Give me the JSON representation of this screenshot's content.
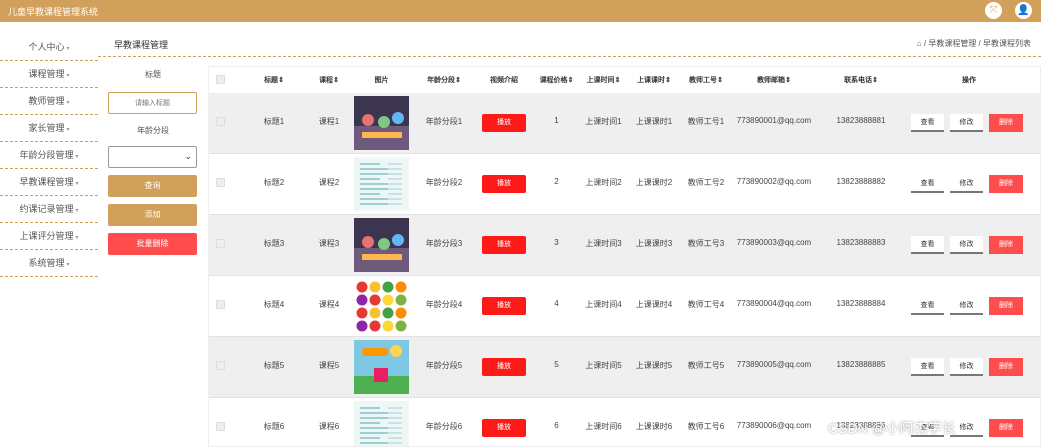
{
  "app": {
    "title": "儿童早教课程管理系统"
  },
  "sidebar": {
    "items": [
      {
        "label": "个人中心"
      },
      {
        "label": "课程管理"
      },
      {
        "label": "教师管理"
      },
      {
        "label": "家长管理"
      },
      {
        "label": "年龄分段管理"
      },
      {
        "label": "早教课程管理"
      },
      {
        "label": "约课记录管理"
      },
      {
        "label": "上课评分管理"
      },
      {
        "label": "系统管理"
      }
    ]
  },
  "page": {
    "title": "早教课程管理",
    "breadcrumb": "/ 早教课程管理 / 早教课程列表"
  },
  "filter": {
    "title_label": "标题",
    "title_placeholder": "请输入标题",
    "age_label": "年龄分段",
    "query": "查询",
    "add": "添加",
    "batch_delete": "批量删除"
  },
  "table": {
    "headers": [
      "标题",
      "课程",
      "图片",
      "年龄分段",
      "视频介绍",
      "课程价格",
      "上课时间",
      "上课课时",
      "教师工号",
      "教师邮箱",
      "联系电话",
      "操作"
    ],
    "play_label": "播放",
    "view_label": "查看",
    "edit_label": "修改",
    "delete_label": "删除",
    "rows": [
      {
        "title": "标题1",
        "course": "课程1",
        "image": "photo",
        "age": "年龄分段1",
        "price": "1",
        "time": "上课时间1",
        "hours": "上课课时1",
        "teacher_no": "教师工号1",
        "email": "773890001@qq.com",
        "phone": "13823888881"
      },
      {
        "title": "标题2",
        "course": "课程2",
        "image": "document",
        "age": "年龄分段2",
        "price": "2",
        "time": "上课时间2",
        "hours": "上课课时2",
        "teacher_no": "教师工号2",
        "email": "773890002@qq.com",
        "phone": "13823888882"
      },
      {
        "title": "标题3",
        "course": "课程3",
        "image": "photo",
        "age": "年龄分段3",
        "price": "3",
        "time": "上课时间3",
        "hours": "上课课时3",
        "teacher_no": "教师工号3",
        "email": "773890003@qq.com",
        "phone": "13823888883"
      },
      {
        "title": "标题4",
        "course": "课程4",
        "image": "fruit",
        "age": "年龄分段4",
        "price": "4",
        "time": "上课时间4",
        "hours": "上课课时4",
        "teacher_no": "教师工号4",
        "email": "773890004@qq.com",
        "phone": "13823888884"
      },
      {
        "title": "标题5",
        "course": "课程5",
        "image": "cartoon",
        "age": "年龄分段5",
        "price": "5",
        "time": "上课时间5",
        "hours": "上课课时5",
        "teacher_no": "教师工号5",
        "email": "773890005@qq.com",
        "phone": "13823888885"
      },
      {
        "title": "标题6",
        "course": "课程6",
        "image": "document",
        "age": "年龄分段6",
        "price": "6",
        "time": "上课时间6",
        "hours": "上课课时6",
        "teacher_no": "教师工号6",
        "email": "773890006@qq.com",
        "phone": "13823888886"
      }
    ]
  },
  "watermark": "CSDN @小阿杰学长",
  "colors": {
    "brand": "#d1a05a",
    "danger": "#ff4d4d",
    "play": "#ff1a1a"
  }
}
